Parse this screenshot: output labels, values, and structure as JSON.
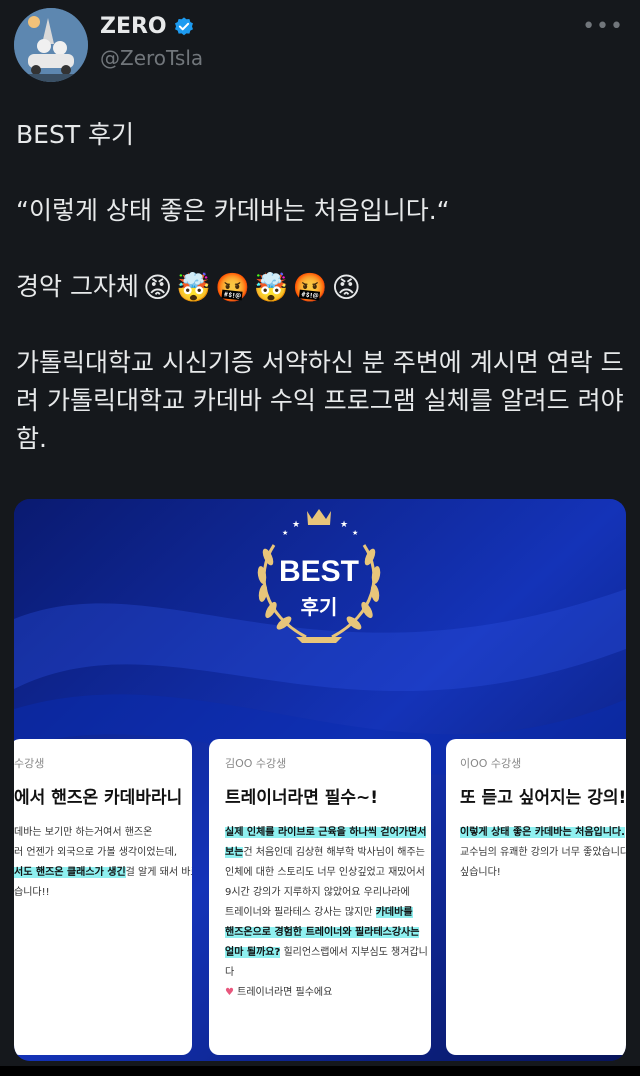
{
  "author": {
    "name": "ZERO",
    "handle": "@ZeroTsla",
    "verified": true,
    "avatar_icon": "avatar-illustration-icon"
  },
  "tweet": {
    "line1": "BEST 후기",
    "line2": "“이렇게 상태 좋은 카데바는 처음입니다.“",
    "line3_text": "경악 그자체",
    "line3_emojis": [
      "😡",
      "🤯",
      "🤬",
      "🤯",
      "🤬",
      "😡"
    ],
    "line4": "가톨릭대학교 시신기증 서약하신 분 주변에 계시면 연락 드려 가톨릭대학교 카데바 수익 프로그램 실체를 알려드 려야함."
  },
  "image": {
    "badge_title": "BEST",
    "badge_sub": "후기",
    "reviews": [
      {
        "student": "수강생",
        "title": "에서 핸즈온 카데바라니",
        "lines": [
          "데바는 보기만 하는거여서 핸즈온",
          "러 언젠가 외국으로 가볼 생각이었는데,"
        ],
        "hl": "서도 핸즈온 클래스가 생긴",
        "after_hl": "걸 알게 돼서 바로",
        "last": "습니다!!"
      },
      {
        "student": "김OO 수강생",
        "title": "트레이너라면 필수~!",
        "hl1": "실제 인체를 라이브로 근육을 하나씩 걷어가면서",
        "hl2": "보는",
        "after_hl2": "건 처음인데 김상현 해부학 박사님이 해주는",
        "lines": [
          "인체에 대한 스토리도 너무 인상깊었고 재밌어서",
          "9시간 강의가 지루하지 않았어요 우리나라에"
        ],
        "line_pre_hl3": "트레이너와 필라테스 강사는 많지만",
        "hl3": "카데바를",
        "hl4": "핸즈온으로 경험한 트레이너와 필라테스강사는",
        "hl5": "얼마 될까요?",
        "after_hl5": "힐리언스랩에서 지부심도 챙겨갑니다",
        "last": "트레이너라면 필수에요"
      },
      {
        "student": "이OO 수강생",
        "title": "또 듣고 싶어지는 강의!",
        "hl": "이렇게 상태 좋은 카데바는 처음입니다.",
        "after_hl": "김상",
        "lines": [
          "교수님의 유쾌한 강의가 너무 좋았습니다. 9",
          "싶습니다!"
        ]
      }
    ]
  },
  "colors": {
    "background": "#15181c",
    "text": "#e7e9ea",
    "muted": "#71767b",
    "verified": "#1d9bf0",
    "highlight": "#8ff0f0",
    "banner_blue": "#0b1e7a"
  }
}
